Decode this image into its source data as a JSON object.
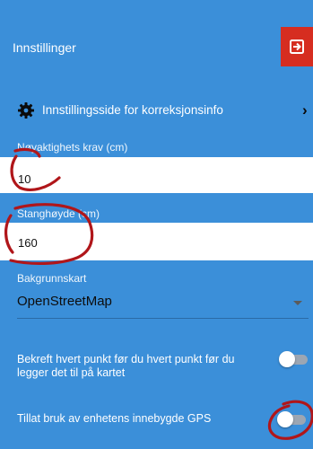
{
  "header": {
    "title": "Innstillinger"
  },
  "correction_settings": {
    "label": "Innstillingsside for korreksjonsinfo"
  },
  "accuracy": {
    "label": "Nøyaktighets krav (cm)",
    "value": "10"
  },
  "pole_height": {
    "label": "Stanghøyde (cm)",
    "value": "160"
  },
  "basemap": {
    "label": "Bakgrunnskart",
    "selected": "OpenStreetMap"
  },
  "confirm_points": {
    "label": "Bekreft hvert punkt før du hvert punkt før du legger det til på kartet",
    "enabled": false
  },
  "builtin_gps": {
    "label": "Tillat bruk av enhetens innebygde GPS",
    "enabled": false
  },
  "colors": {
    "appbar": "#3b8fd9",
    "exit_button": "#d62d20",
    "annotation": "#b0161a"
  }
}
